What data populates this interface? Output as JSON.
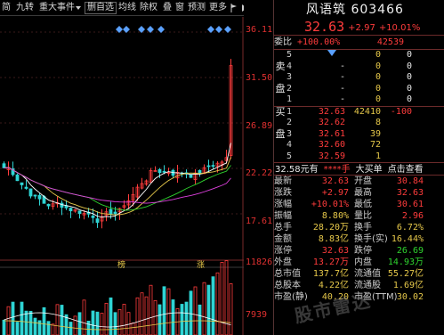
{
  "toolbar": {
    "items": [
      "简",
      "九转",
      "重大事件",
      "删自选",
      "均线",
      "除权",
      "叠",
      "窗",
      "预测",
      "更多"
    ],
    "icons": [
      "dropdown-arrow",
      "flag-icon",
      "next-arrow"
    ]
  },
  "chart": {
    "price_axis": [
      "36.11",
      "31.50",
      "26.89",
      "22.22",
      "17.61"
    ],
    "volume_axis": [
      "11826",
      "7939"
    ],
    "bottom_labels": [
      "榜",
      "涨"
    ],
    "marker_color": "#5aa0ff",
    "up_color": "#ff3c3c",
    "down_color": "#2fd4d4",
    "ma_colors": [
      "#ffffff",
      "#e6c84a",
      "#2fd42f",
      "#e040e0"
    ]
  },
  "stock": {
    "name": "风语筑",
    "code": "603466",
    "price": "32.63",
    "change": "+2.97",
    "change_pct": "+10.01%"
  },
  "orderbook": {
    "weibi_label": "委比",
    "weibi_value": "+100.00%",
    "weicha_value": "42539",
    "sell_label": [
      "卖",
      "盘"
    ],
    "buy_label": [
      "买",
      "盘"
    ],
    "asks": [
      {
        "lvl": "5",
        "price": "",
        "vol": "0",
        "cnt": "0"
      },
      {
        "lvl": "4",
        "price": "-",
        "vol": "0",
        "cnt": "0"
      },
      {
        "lvl": "3",
        "price": "-",
        "vol": "0",
        "cnt": "0"
      },
      {
        "lvl": "2",
        "price": "-",
        "vol": "0",
        "cnt": "0"
      },
      {
        "lvl": "1",
        "price": "-",
        "vol": "0",
        "cnt": "0"
      }
    ],
    "bids": [
      {
        "lvl": "1",
        "price": "32.63",
        "vol": "42410",
        "cnt": "-100"
      },
      {
        "lvl": "2",
        "price": "32.62",
        "vol": "8",
        "cnt": ""
      },
      {
        "lvl": "3",
        "price": "32.61",
        "vol": "39",
        "cnt": ""
      },
      {
        "lvl": "4",
        "price": "32.60",
        "vol": "72",
        "cnt": ""
      },
      {
        "lvl": "5",
        "price": "32.59",
        "vol": "1",
        "cnt": ""
      }
    ]
  },
  "trade_bar": {
    "price": "32.58元有",
    "mask": "****手",
    "big": "大买单",
    "link": "点击查看"
  },
  "stats": [
    {
      "l": "最新",
      "v": "32.63",
      "vc": "red",
      "l2": "开盘",
      "v2": "30.84",
      "v2c": "red"
    },
    {
      "l": "涨跌",
      "v": "+2.97",
      "vc": "red",
      "l2": "最高",
      "v2": "32.63",
      "v2c": "red"
    },
    {
      "l": "涨幅",
      "v": "+10.01%",
      "vc": "red",
      "l2": "最低",
      "v2": "30.61",
      "v2c": "red"
    },
    {
      "l": "振幅",
      "v": "8.80%",
      "vc": "yellow",
      "l2": "量比",
      "v2": "2.96",
      "v2c": "red"
    },
    {
      "l": "总手",
      "v": "28.20万",
      "vc": "yellow",
      "l2": "换手",
      "v2": "6.72%",
      "v2c": "yellow"
    },
    {
      "l": "金额",
      "v": "8.83亿",
      "vc": "yellow",
      "l2": "换手(实)",
      "v2": "16.44%",
      "v2c": "yellow"
    },
    {
      "l": "涨停",
      "v": "32.63",
      "vc": "red",
      "l2": "跌停",
      "v2": "26.69",
      "v2c": "green"
    },
    {
      "l": "外盘",
      "v": "13.27万",
      "vc": "red",
      "l2": "内盘",
      "v2": "14.93万",
      "v2c": "green"
    },
    {
      "l": "总市值",
      "v": "137.7亿",
      "vc": "yellow",
      "l2": "流通值",
      "v2": "55.27亿",
      "v2c": "yellow"
    },
    {
      "l": "总股本",
      "v": "4.22亿",
      "vc": "yellow",
      "l2": "流通股",
      "v2": "1.69亿",
      "v2c": "yellow"
    },
    {
      "l": "市盈(静)",
      "v": "40.20",
      "vc": "yellow",
      "l2": "市盈(TTM)",
      "v2": "30.02",
      "v2c": "yellow"
    }
  ],
  "watermark": "股市雷达"
}
